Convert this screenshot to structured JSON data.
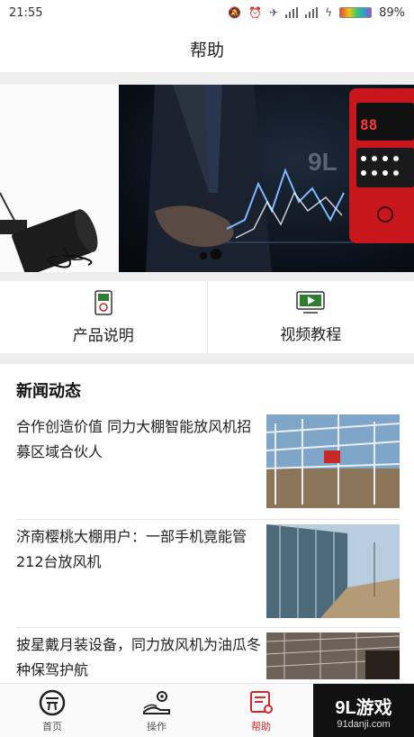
{
  "status_bar": {
    "time": "21:55",
    "battery": "89%"
  },
  "page_title": "帮助",
  "quick_links": [
    {
      "label": "产品说明",
      "icon": "device-icon"
    },
    {
      "label": "视频教程",
      "icon": "video-play-icon"
    }
  ],
  "news": {
    "section_title": "新闻动态",
    "items": [
      {
        "title": "合作创造价值 同力大棚智能放风机招募区域合伙人"
      },
      {
        "title": "济南樱桃大棚用户：一部手机竟能管212台放风机"
      },
      {
        "title": "披星戴月装设备，同力放风机为油瓜冬种保驾护航"
      }
    ]
  },
  "tabs": [
    {
      "label": "首页",
      "active": false
    },
    {
      "label": "操作",
      "active": false
    },
    {
      "label": "帮助",
      "active": true
    }
  ],
  "watermark": {
    "main": "9L游戏",
    "sub": "91danji.com"
  },
  "colors": {
    "accent": "#d8252b",
    "background_gap": "#eeeeee"
  }
}
